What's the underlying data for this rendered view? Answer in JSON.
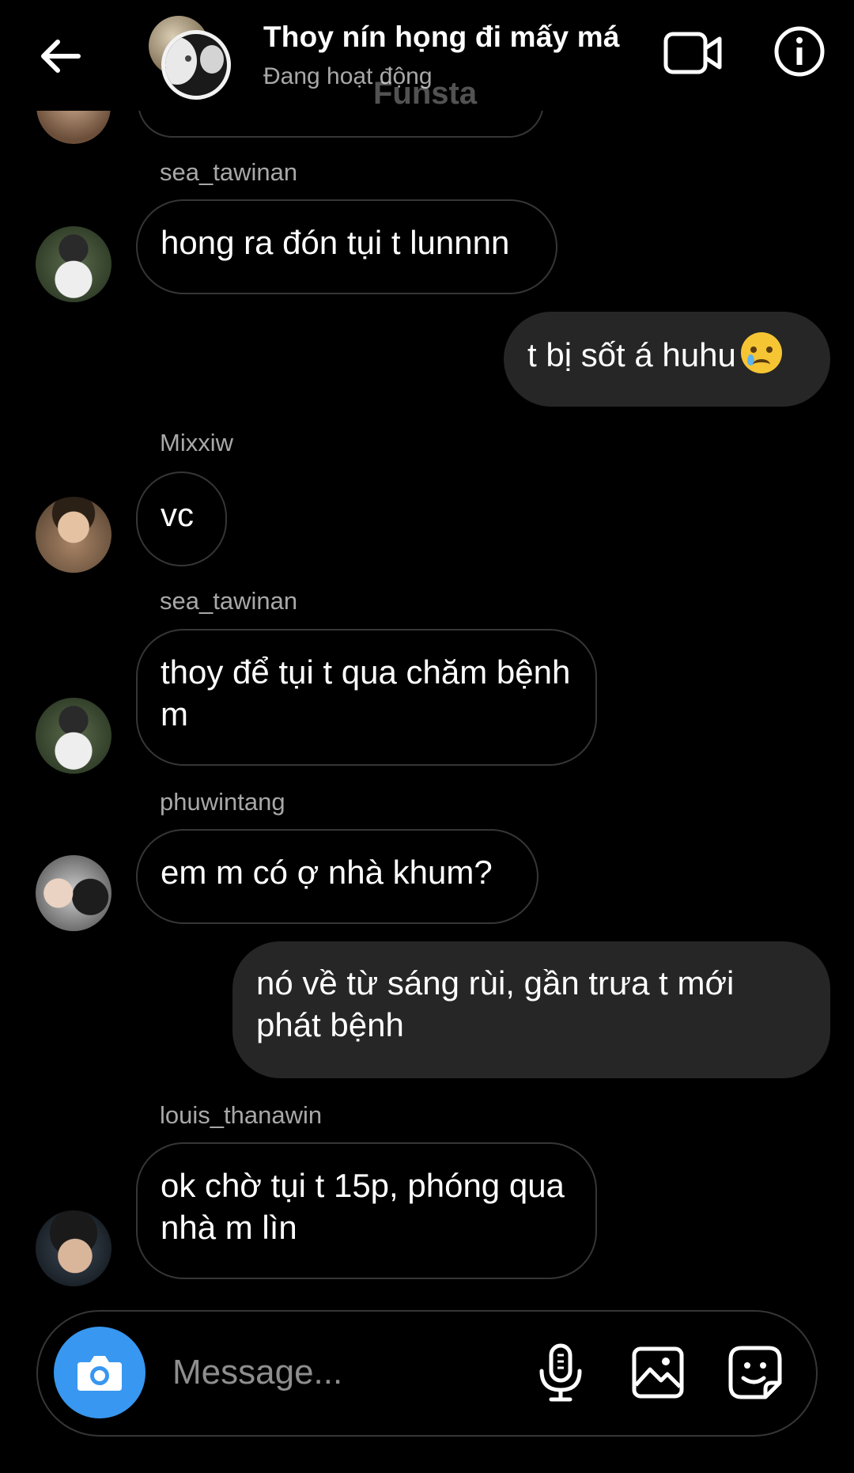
{
  "header": {
    "title": "Thoy nín họng đi mấy má",
    "status": "Đang hoạt động",
    "watermark": "Funsta"
  },
  "messages": [
    {
      "sender": "sea_tawinan",
      "text": "hong ra đón tụi t lunnnn",
      "direction": "in"
    },
    {
      "text": "t bị sốt á huhu",
      "emoji": "crying-face",
      "direction": "out"
    },
    {
      "sender": "Mixxiw",
      "text": "vc",
      "direction": "in"
    },
    {
      "sender": "sea_tawinan",
      "text": "thoy để tụi t qua chăm bệnh m",
      "direction": "in"
    },
    {
      "sender": "phuwintang",
      "text": "em m có ợ nhà khum?",
      "direction": "in"
    },
    {
      "text": "nó về từ sáng rùi, gần trưa t mới phát bệnh",
      "direction": "out"
    },
    {
      "sender": "louis_thanawin",
      "text": "ok chờ tụi t 15p, phóng qua nhà m lìn",
      "direction": "in"
    }
  ],
  "composer": {
    "placeholder": "Message..."
  },
  "colors": {
    "background": "#000000",
    "outgoing_bubble": "#262626",
    "bubble_border": "#363636",
    "camera_button": "#3897f0",
    "secondary_text": "#a8a8a8"
  }
}
